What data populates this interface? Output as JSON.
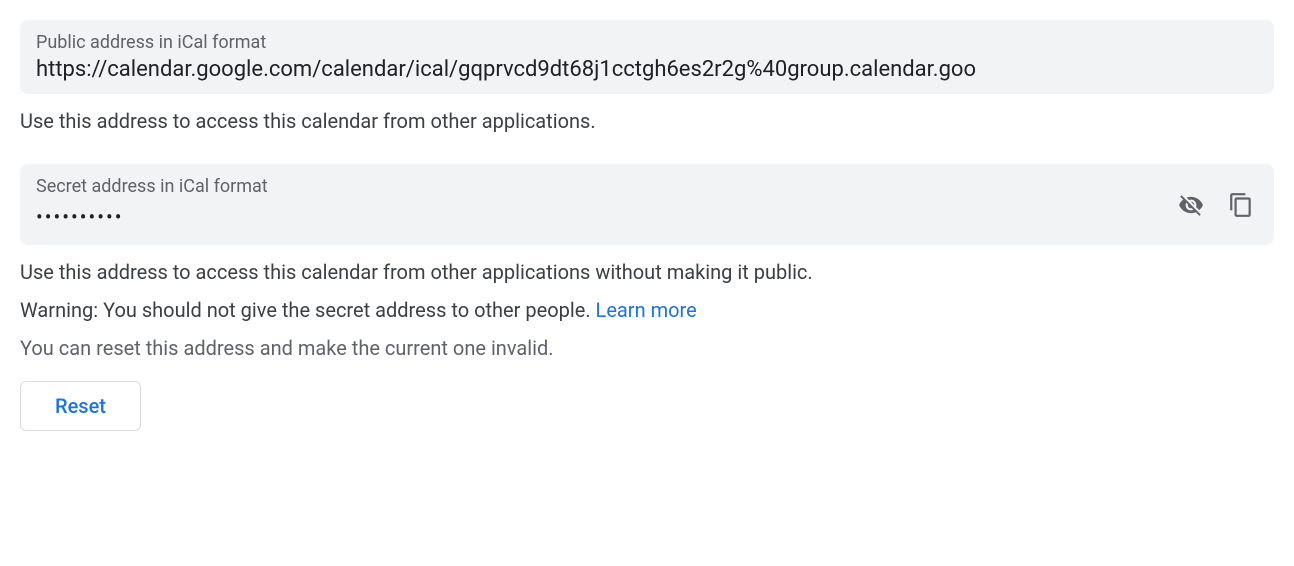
{
  "public": {
    "label": "Public address in iCal format",
    "value": "https://calendar.google.com/calendar/ical/gqprvcd9dt68j1cctgh6es2r2g%40group.calendar.goo",
    "helper": "Use this address to access this calendar from other applications."
  },
  "secret": {
    "label": "Secret address in iCal format",
    "value": "••••••••••",
    "helper": "Use this address to access this calendar from other applications without making it public.",
    "warning_prefix": "Warning: You should not give the secret address to other people. ",
    "learn_more": "Learn more",
    "reset_help": "You can reset this address and make the current one invalid.",
    "reset_button": "Reset"
  }
}
